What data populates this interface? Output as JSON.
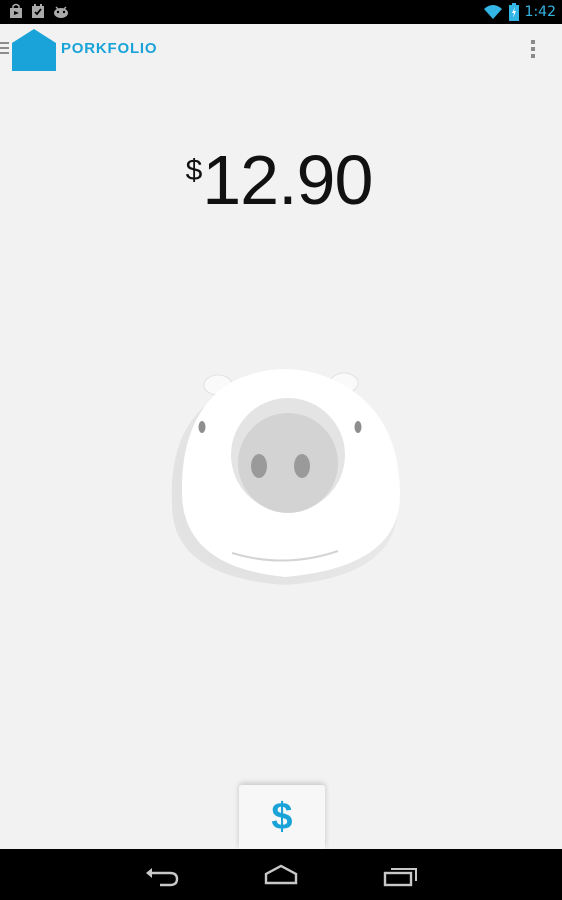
{
  "status_bar": {
    "left_icons": [
      "store-icon",
      "checkbox-icon",
      "android-icon"
    ],
    "right_icons": [
      "wifi-icon",
      "battery-charging-icon"
    ],
    "time": "1:42",
    "accent_color": "#33b5e5"
  },
  "action_bar": {
    "icons": [
      "drawer-icon",
      "house-logo-icon",
      "overflow-menu-icon"
    ],
    "title": "PORKFOLIO",
    "brand_color": "#1aa3d8"
  },
  "balance": {
    "currency_symbol": "$",
    "amount": "12.90"
  },
  "pig": {
    "icon": "pig-face-icon"
  },
  "dollar_tab": {
    "label": "$"
  },
  "nav_bar": {
    "icons": [
      "back-icon",
      "home-icon",
      "recent-apps-icon"
    ]
  }
}
